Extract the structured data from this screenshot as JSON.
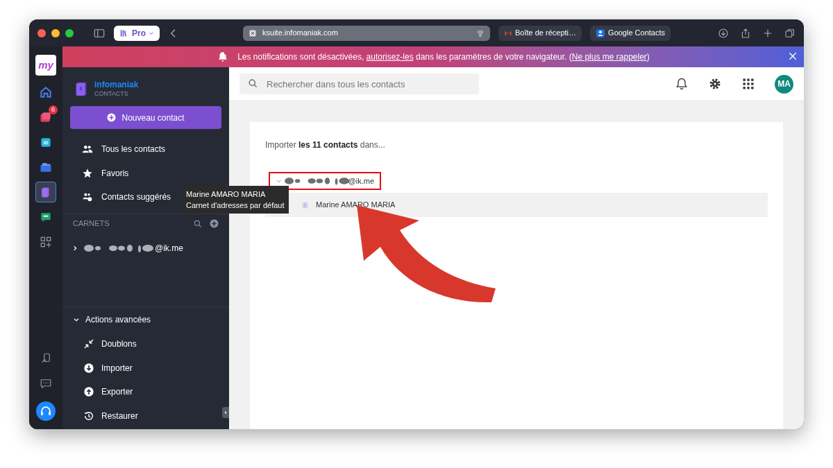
{
  "browser": {
    "tab_group": "Pro",
    "url": "ksuite.infomaniak.com",
    "tabs": [
      {
        "title": "Boîte de récepti…",
        "kind": "mail"
      },
      {
        "title": "Google Contacts",
        "kind": "contacts"
      }
    ]
  },
  "banner": {
    "parts": [
      {
        "kind": "text",
        "text": "Les notifications sont désactivées, "
      },
      {
        "kind": "link",
        "text": "autorisez-les"
      },
      {
        "kind": "text",
        "text": " dans les paramètres de votre navigateur. ("
      },
      {
        "kind": "link",
        "text": "Ne plus me rappeler"
      },
      {
        "kind": "text",
        "text": ")"
      }
    ]
  },
  "rail": {
    "logo": "my",
    "apps": [
      {
        "kind": "home",
        "selected": false
      },
      {
        "kind": "mail",
        "selected": false,
        "badge": "6"
      },
      {
        "kind": "calendar",
        "selected": false
      },
      {
        "kind": "drive",
        "selected": false
      },
      {
        "kind": "contacts",
        "selected": true
      },
      {
        "kind": "chat",
        "selected": false
      },
      {
        "kind": "grid",
        "selected": false
      }
    ],
    "bottom": [
      {
        "kind": "device"
      },
      {
        "kind": "feedback"
      },
      {
        "kind": "support"
      }
    ]
  },
  "sidebar": {
    "brand": "infomaniak",
    "product": "CONTACTS",
    "new_button": "Nouveau contact",
    "nav": [
      {
        "label": "Tous les contacts",
        "kind": "people"
      },
      {
        "label": "Favoris",
        "kind": "star"
      },
      {
        "label": "Contacts suggérés",
        "kind": "suggest"
      }
    ],
    "books_title": "CARNETS",
    "books": [
      {
        "address": "@ik.me",
        "expanded": false
      }
    ],
    "advanced": {
      "title": "Actions avancées",
      "expanded": true,
      "items": [
        {
          "label": "Doublons",
          "kind": "merge"
        },
        {
          "label": "Importer",
          "kind": "import"
        },
        {
          "label": "Exporter",
          "kind": "export"
        },
        {
          "label": "Restaurer",
          "kind": "restore"
        }
      ]
    }
  },
  "topbar": {
    "search": {
      "placeholder": "Rechercher dans tous les contacts"
    },
    "avatar": "MA"
  },
  "card": {
    "intro": "Importer **les 11 contacts** dans...",
    "tree": {
      "address": "@ik.me",
      "expanded": true,
      "children": [
        {
          "name": "Marine AMARO MARIA"
        }
      ]
    }
  },
  "tooltip": {
    "lines": [
      "Marine AMARO MARIA",
      "Carnet d'adresses par défaut"
    ]
  }
}
